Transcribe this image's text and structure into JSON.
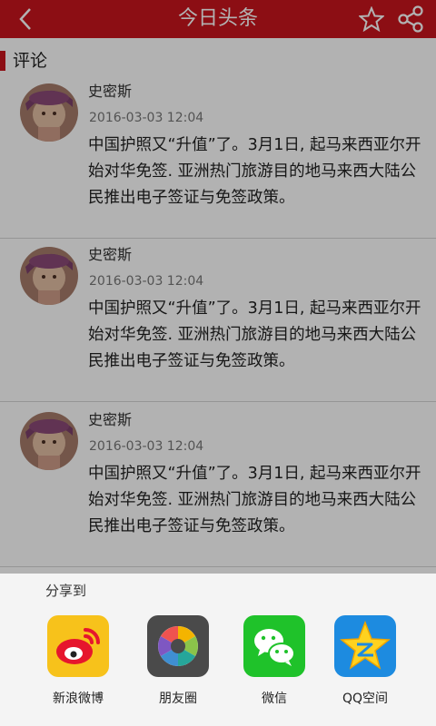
{
  "header": {
    "title": "今日头条",
    "back_icon": "chevron-left-icon",
    "star_icon": "star-outline-icon",
    "share_icon": "share-icon"
  },
  "section": {
    "label": "评论"
  },
  "comments": [
    {
      "author": "史密斯",
      "time": "2016-03-03  12:04",
      "text": "中国护照又“升值”了。3月1日, 起马来西亚尔开始对华免签. 亚洲热门旅游目的地马来西大陆公民推出电子签证与免签政策。"
    },
    {
      "author": "史密斯",
      "time": "2016-03-03  12:04",
      "text": "中国护照又“升值”了。3月1日, 起马来西亚尔开始对华免签. 亚洲热门旅游目的地马来西大陆公民推出电子签证与免签政策。"
    },
    {
      "author": "史密斯",
      "time": "2016-03-03  12:04",
      "text": "中国护照又“升值”了。3月1日, 起马来西亚尔开始对华免签. 亚洲热门旅游目的地马来西大陆公民推出电子签证与免签政策。"
    }
  ],
  "share": {
    "title": "分享到",
    "items": [
      {
        "label": "新浪微博",
        "icon": "weibo-icon",
        "color": "#f7c21b"
      },
      {
        "label": "朋友圈",
        "icon": "moments-icon",
        "color": "#4a4a4a"
      },
      {
        "label": "微信",
        "icon": "wechat-icon",
        "color": "#1fc22a"
      },
      {
        "label": "QQ空间",
        "icon": "qzone-icon",
        "color": "#1d8be0"
      }
    ]
  },
  "colors": {
    "accent": "#c9151e"
  }
}
